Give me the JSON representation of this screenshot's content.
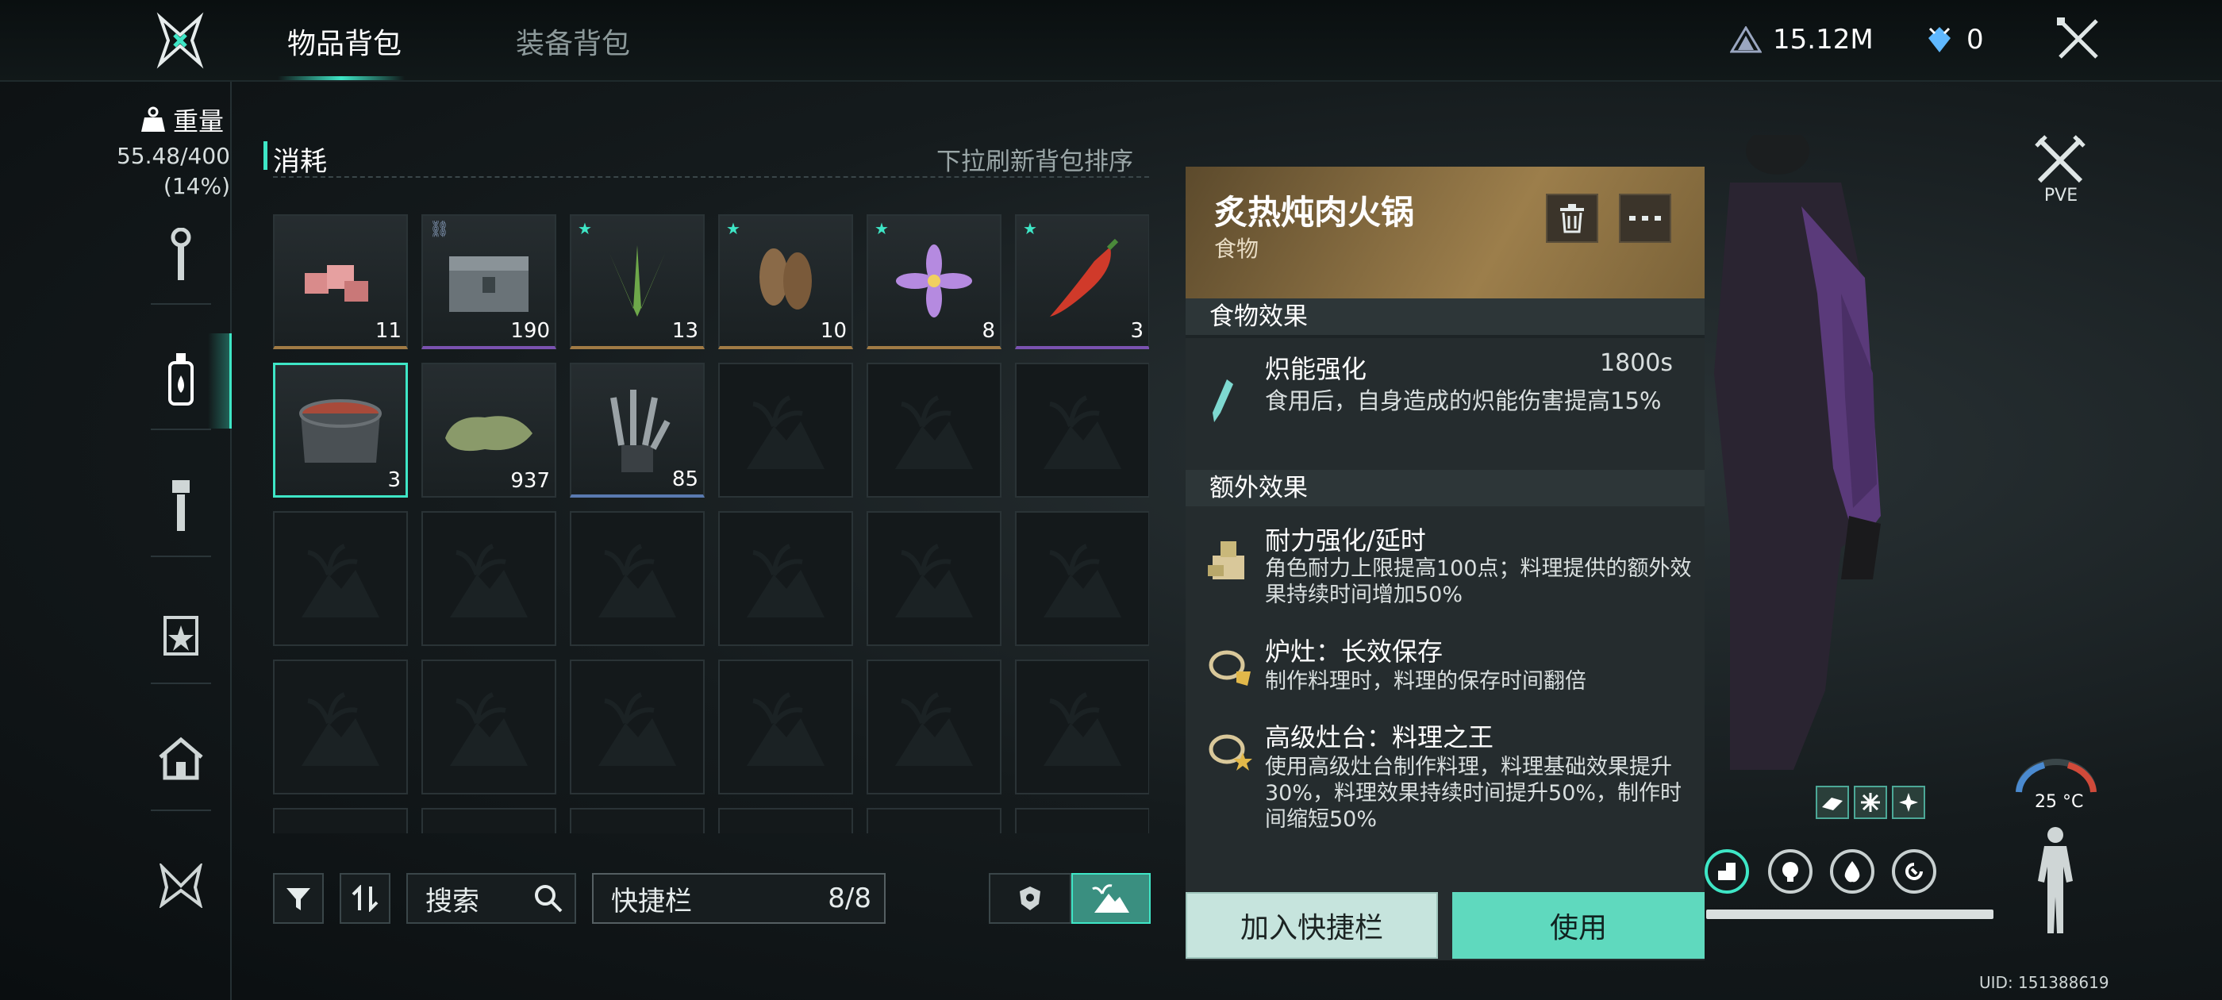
{
  "header": {
    "tabs": [
      {
        "label": "物品背包"
      },
      {
        "label": "装备背包"
      }
    ],
    "currency_value": "15.12M",
    "gem_value": "0"
  },
  "sidebar": {
    "weight_label": "重量",
    "weight_value": "55.48/400",
    "weight_percent": "(14%)",
    "icons": [
      "wrench-icon",
      "bottle-icon",
      "tool-icon",
      "calendar-star-icon",
      "house-icon",
      "butterfly-icon"
    ],
    "selected": "bottle-icon"
  },
  "inventory": {
    "category": "消耗",
    "hint": "下拉刷新背包排序",
    "items": [
      {
        "name": "meat",
        "count": "11",
        "rarity": "gold",
        "star": false,
        "link": false
      },
      {
        "name": "chest",
        "count": "190",
        "rarity": "purple",
        "star": false,
        "link": true
      },
      {
        "name": "aloe",
        "count": "13",
        "rarity": "gold",
        "star": true,
        "link": false
      },
      {
        "name": "morel",
        "count": "10",
        "rarity": "gold",
        "star": true,
        "link": false
      },
      {
        "name": "flower",
        "count": "8",
        "rarity": "gold",
        "star": true,
        "link": false
      },
      {
        "name": "chili",
        "count": "3",
        "rarity": "purple",
        "star": true,
        "link": false
      },
      {
        "name": "stew-pot",
        "count": "3",
        "rarity": "selected",
        "star": false,
        "link": false
      },
      {
        "name": "moss",
        "count": "937",
        "rarity": "none",
        "star": false,
        "link": false
      },
      {
        "name": "claw-device",
        "count": "85",
        "rarity": "blue",
        "star": false,
        "link": false
      }
    ]
  },
  "toolbar": {
    "search_label": "搜索",
    "quickbar_label": "快捷栏",
    "quickbar_count": "8/8"
  },
  "detail": {
    "title": "炙热炖肉火锅",
    "subtitle": "食物",
    "food_effect_header": "食物效果",
    "main_effect": {
      "title": "炽能强化",
      "duration": "1800s",
      "desc": "食用后，自身造成的炽能伤害提高15%"
    },
    "extra_header": "额外效果",
    "extras": [
      {
        "title": "耐力强化/延时",
        "desc": "角色耐力上限提高100点；料理提供的额外效果持续时间增加50%"
      },
      {
        "title": "炉灶：长效保存",
        "desc": "制作料理时，料理的保存时间翻倍"
      },
      {
        "title": "高级灶台：料理之王",
        "desc": "使用高级灶台制作料理，料理基础效果提升30%，料理效果持续时间提升50%，制作时间缩短50%"
      }
    ],
    "add_button": "加入快捷栏",
    "use_button": "使用"
  },
  "status": {
    "pve_label": "PVE",
    "temperature": "25 °C",
    "uid": "UID: 151388619"
  },
  "colors": {
    "accent": "#3ee6c6",
    "gold": "#a07a45",
    "purple": "#7a52b0"
  }
}
